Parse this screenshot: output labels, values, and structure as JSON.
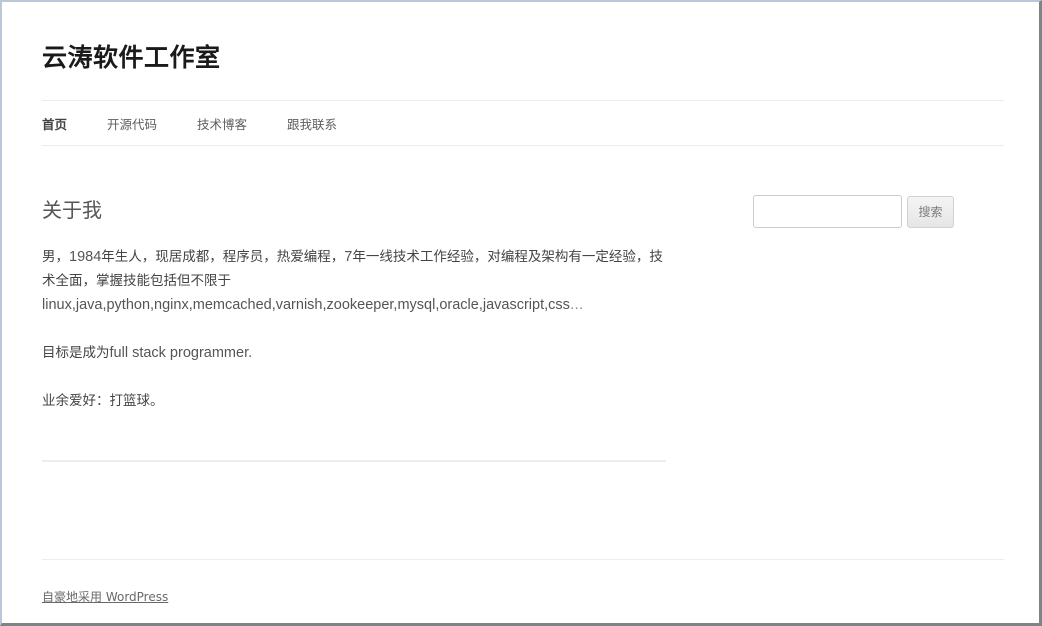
{
  "site": {
    "title": "云涛软件工作室"
  },
  "nav": {
    "items": [
      {
        "label": "首页",
        "current": true
      },
      {
        "label": "开源代码"
      },
      {
        "label": "技术博客"
      },
      {
        "label": "跟我联系"
      }
    ]
  },
  "page": {
    "title": "关于我",
    "paragraph1_pre": "男，",
    "paragraph1_year": "1984",
    "paragraph1_mid": "年生人，现居成都，程序员，热爱编程，",
    "paragraph1_num": "7",
    "paragraph1_post": "年一线技术工作经验，对编程及架构有一定经验，技术全面，掌握技能包括但不限于",
    "paragraph1_tech": "linux,java,python,nginx,memcached,varnish,zookeeper,mysql,oracle,javascript,css",
    "paragraph1_ellipsis": "…",
    "paragraph2_pre": "目标是成为",
    "paragraph2_latin": "full stack programmer.",
    "paragraph3": "业余爱好：打篮球。"
  },
  "search": {
    "placeholder": "",
    "button_label": "搜索"
  },
  "footer": {
    "credit": "自豪地采用 WordPress"
  }
}
